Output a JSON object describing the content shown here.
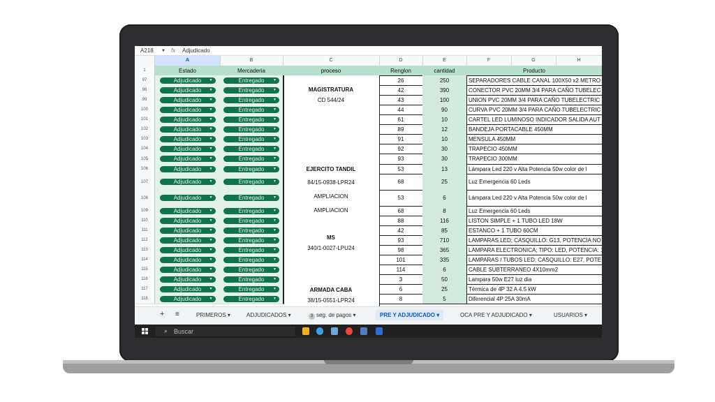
{
  "formula": {
    "cell_ref": "A218",
    "fx": "fx",
    "value": "Adjudicado"
  },
  "columns": [
    "A",
    "B",
    "C",
    "D",
    "E",
    "F",
    "G",
    "H"
  ],
  "header_row": {
    "num": "1",
    "estado": "Estado",
    "mercaderia": "Mercaderia",
    "proceso": "proceso",
    "renglon": "Renglon",
    "cantidad": "cantidad",
    "producto": "Producto"
  },
  "chip_estado": "Adjudicado",
  "chip_mercaderia": "Entregado",
  "rows": [
    {
      "n": "97",
      "d": "26",
      "e": "250",
      "f": "SEPARADORES CABLE CANAL 100X50 x2 METRO"
    },
    {
      "n": "98",
      "d": "42",
      "e": "390",
      "f": "CONECTOR PVC 20MM 3/4 PARA CAÑO TUBELEC"
    },
    {
      "n": "99",
      "d": "43",
      "e": "100",
      "f": "UNION PVC 20MM 3/4 PARA CAÑO TUBELECTRIC"
    },
    {
      "n": "100",
      "d": "44",
      "e": "90",
      "f": "CURVA PVC 20MM 3/4 PARA CAÑO TUBELECTRIC"
    },
    {
      "n": "101",
      "d": "61",
      "e": "10",
      "f": "CARTEL LED LUMINOSO INDICADOR SALIDA AUT"
    },
    {
      "n": "102",
      "d": "89",
      "e": "12",
      "f": "BANDEJA PORTACABLE 450MM"
    },
    {
      "n": "103",
      "d": "91",
      "e": "10",
      "f": "MENSULA 450MM"
    },
    {
      "n": "104",
      "d": "92",
      "e": "30",
      "f": "TRAPECIO 450MM"
    },
    {
      "n": "105",
      "d": "93",
      "e": "30",
      "f": "TRAPECIO 300MM"
    },
    {
      "n": "106",
      "d": "53",
      "e": "13",
      "f": "Lámpara Led 220 v Alta Potencia 50w color de l"
    },
    {
      "n": "107",
      "d": "68",
      "e": "25",
      "f": "Luz Emergencia 60 Leds"
    },
    {
      "n": "108",
      "d": "53",
      "e": "6",
      "f": "Lámpara Led 220 v Alta Potencia 50w color de l"
    },
    {
      "n": "109",
      "d": "68",
      "e": "8",
      "f": "Luz Emergencia 60 Leds"
    },
    {
      "n": "110",
      "d": "88",
      "e": "116",
      "f": "LISTON SIMPLE + 1 TUBO LED 18W"
    },
    {
      "n": "111",
      "d": "42",
      "e": "85",
      "f": "ESTANCO + 1 TUBO 60CM"
    },
    {
      "n": "112",
      "d": "93",
      "e": "710",
      "f": "LAMPARAS LED; CASQUILLO: G13, POTENCIA NO"
    },
    {
      "n": "113",
      "d": "98",
      "e": "365",
      "f": "LAMPARA ELECTRONICA; TIPO: LED, POTENCIA: 1"
    },
    {
      "n": "114",
      "d": "101",
      "e": "335",
      "f": "LAMPARAS / TUBOS LED; CASQUILLO: E27, POTE"
    },
    {
      "n": "115",
      "d": "114",
      "e": "6",
      "f": "CABLE SUBTERRANEO 4X10mm2"
    },
    {
      "n": "116",
      "d": "3",
      "e": "50",
      "f": "Lampara 50w E27 luz dia"
    },
    {
      "n": "117",
      "d": "6",
      "e": "25",
      "f": "Térmica de 4P 32 A 4.5 kW"
    },
    {
      "n": "118",
      "d": "8",
      "e": "5",
      "f": "Diferencial 4P 25A 30mA"
    }
  ],
  "procesos": {
    "magistratura": "MAGISTRATURA",
    "magistratura_cd": "CD 544/24",
    "ejercito": "EJERCITO TANDIL",
    "ejercito_num": "84/15-0938-LPR24",
    "ampliacion1": "AMPLIACION",
    "ampliacion2": "AMPLIACION",
    "ms": "MS",
    "ms_num": "340/1-0027-LPU24",
    "armada": "ARMADA CABA",
    "armada_num": "38/15-0551-LPR24"
  },
  "tabs": {
    "add": "+",
    "menu": "≡",
    "primeros": "PRIMEROS",
    "adjudicados": "ADJUDICADOS",
    "seg_badge": "3",
    "seg": "seg. de pagos",
    "pre_adj": "PRE Y ADJUDICADO",
    "oca": "OCA PRE Y ADJUDICADO",
    "usuarios": "USUARIOS",
    "caret": "▾"
  },
  "taskbar": {
    "search": "Buscar"
  }
}
